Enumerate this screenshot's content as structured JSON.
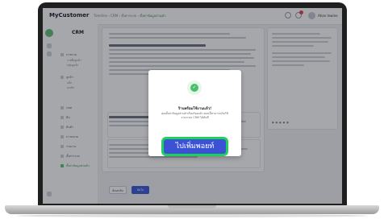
{
  "topbar": {
    "brand": "MyCustomer",
    "breadcrumb": [
      "Timeline",
      "CRM",
      "ตั้งค่าระบบ",
      "ตั้งค่าข้อมูลส่วนตัว"
    ],
    "user_name": "Ahan Inwine"
  },
  "sidebar": {
    "title": "CRM",
    "items": [
      {
        "label": "ภาพรวม",
        "active": false
      },
      {
        "label": "ลูกค้า",
        "active": false
      },
      {
        "label": "แชท",
        "active": false
      },
      {
        "label": "ดีล",
        "active": false
      },
      {
        "label": "สินค้า",
        "active": false
      },
      {
        "label": "การตลาด",
        "active": false
      },
      {
        "label": "รายงาน",
        "active": false
      },
      {
        "label": "ตั้งค่าระบบ",
        "active": false
      },
      {
        "label": "ตั้งค่าข้อมูลส่วนตัว",
        "active": true
      }
    ],
    "subitems": [
      "รายชื่อลูกค้า",
      "กลุ่มลูกค้า",
      "แท็ก",
      "ยกเลิก"
    ]
  },
  "actions": {
    "back_label": "ย้อนกลับ",
    "next_label": "ถัดไป"
  },
  "modal": {
    "title": "ร้านพร้อมใช้งานแล้ว!",
    "body": "คุณตั้งค่าข้อมูลส่วนตัวเรียบร้อยแล้ว ตอนนี้สามารถเริ่มใช้งานระบบ CRM ได้ทันที",
    "cta_label": "ไปเพิ่มพอยท์",
    "check_icon": "check-icon"
  },
  "colors": {
    "accent": "#3b52d6",
    "success": "#4cbe6a",
    "highlight": "#1fd05c"
  }
}
